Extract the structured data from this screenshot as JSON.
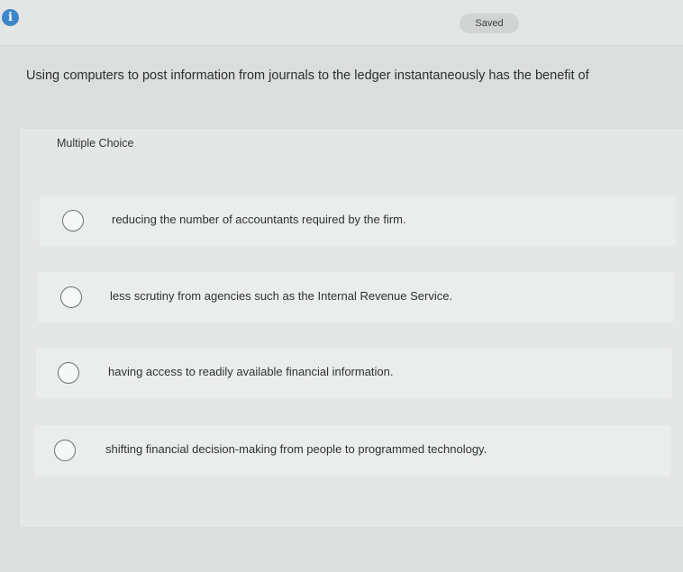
{
  "header": {
    "info_icon": "info-icon",
    "info_glyph": "i",
    "saved_label": "Saved"
  },
  "question": {
    "text": "Using computers to post information from journals to the ledger instantaneously has the benefit of"
  },
  "choices": {
    "type_label": "Multiple Choice",
    "options": [
      {
        "label": "reducing the number of accountants required by the firm."
      },
      {
        "label": "less scrutiny from agencies such as the Internal Revenue Service."
      },
      {
        "label": "having access to readily available financial information."
      },
      {
        "label": "shifting financial decision-making from people to programmed technology."
      }
    ]
  },
  "colors": {
    "info_icon": "#3d87c9",
    "background": "#dcdedd"
  }
}
